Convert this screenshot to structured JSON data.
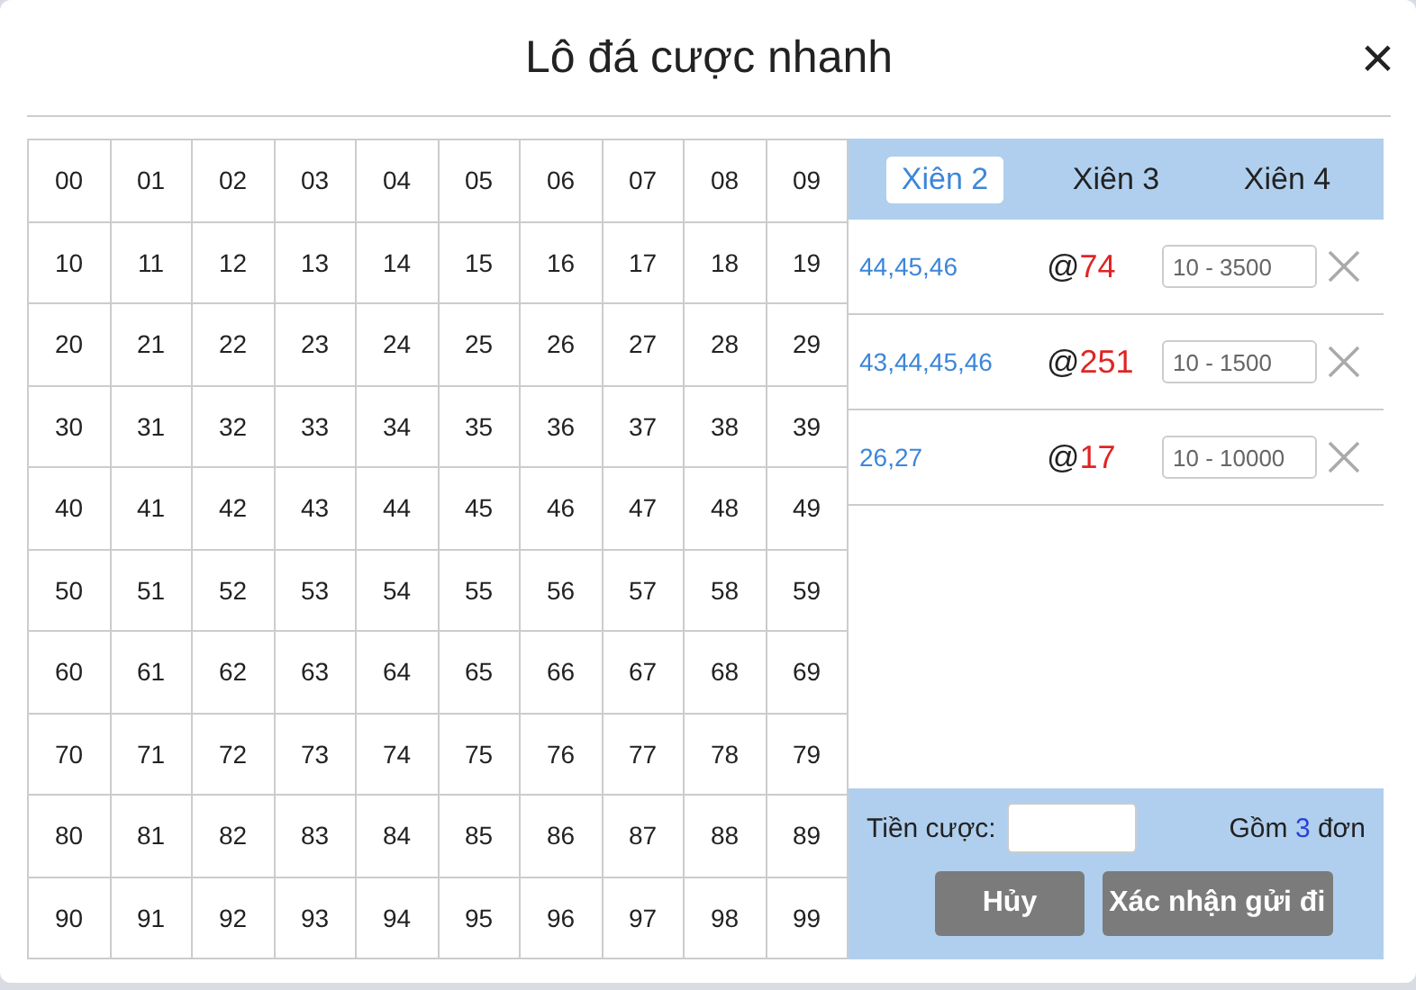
{
  "dialog": {
    "title": "Lô đá cược nhanh",
    "close": "×"
  },
  "numbers": [
    "00",
    "01",
    "02",
    "03",
    "04",
    "05",
    "06",
    "07",
    "08",
    "09",
    "10",
    "11",
    "12",
    "13",
    "14",
    "15",
    "16",
    "17",
    "18",
    "19",
    "20",
    "21",
    "22",
    "23",
    "24",
    "25",
    "26",
    "27",
    "28",
    "29",
    "30",
    "31",
    "32",
    "33",
    "34",
    "35",
    "36",
    "37",
    "38",
    "39",
    "40",
    "41",
    "42",
    "43",
    "44",
    "45",
    "46",
    "47",
    "48",
    "49",
    "50",
    "51",
    "52",
    "53",
    "54",
    "55",
    "56",
    "57",
    "58",
    "59",
    "60",
    "61",
    "62",
    "63",
    "64",
    "65",
    "66",
    "67",
    "68",
    "69",
    "70",
    "71",
    "72",
    "73",
    "74",
    "75",
    "76",
    "77",
    "78",
    "79",
    "80",
    "81",
    "82",
    "83",
    "84",
    "85",
    "86",
    "87",
    "88",
    "89",
    "90",
    "91",
    "92",
    "93",
    "94",
    "95",
    "96",
    "97",
    "98",
    "99"
  ],
  "tabs": [
    {
      "label": "Xiên 2",
      "selected": true
    },
    {
      "label": "Xiên 3",
      "selected": false
    },
    {
      "label": "Xiên 4",
      "selected": false
    }
  ],
  "bets": [
    {
      "numbers": "44,45,46",
      "at": "@",
      "odds": "74",
      "placeholder": "10 - 3500"
    },
    {
      "numbers": "43,44,45,46",
      "at": "@",
      "odds": "251",
      "placeholder": "10 - 1500"
    },
    {
      "numbers": "26,27",
      "at": "@",
      "odds": "17",
      "placeholder": "10 - 10000"
    }
  ],
  "footer": {
    "stake_label": "Tiền cược:",
    "count_prefix": "Gồm",
    "count": "3",
    "count_suffix": "đơn",
    "buttons": [
      {
        "label": "Hủy"
      },
      {
        "label": "Xác nhận gửi đi"
      }
    ]
  }
}
